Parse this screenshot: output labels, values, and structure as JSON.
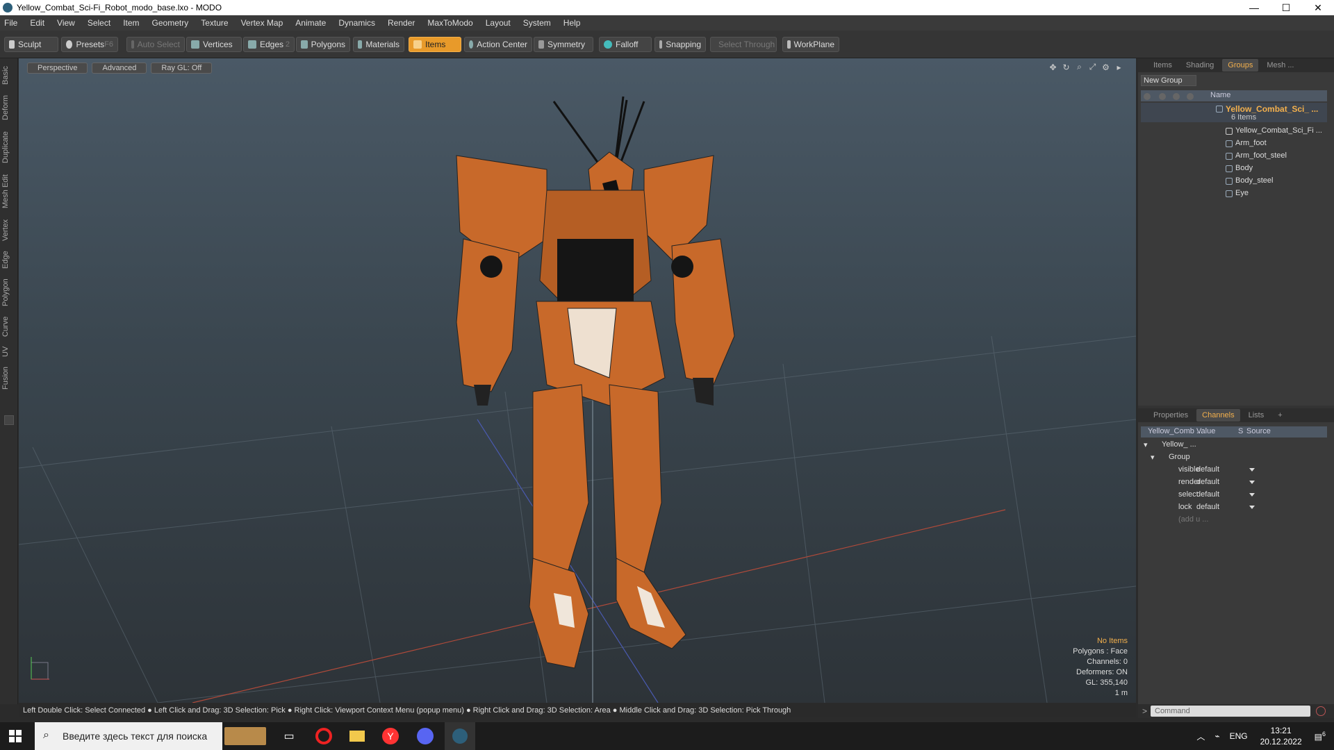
{
  "window": {
    "title": "Yellow_Combat_Sci-Fi_Robot_modo_base.lxo - MODO",
    "min": "—",
    "max": "☐",
    "close": "✕"
  },
  "menu": [
    "File",
    "Edit",
    "View",
    "Select",
    "Item",
    "Geometry",
    "Texture",
    "Vertex Map",
    "Animate",
    "Dynamics",
    "Render",
    "MaxToModo",
    "Layout",
    "System",
    "Help"
  ],
  "toolbar": {
    "sculpt": "Sculpt",
    "presets": "Presets",
    "presets_key": "F6",
    "auto_select": "Auto Select",
    "vertices": "Vertices",
    "edges": "Edges",
    "edges_num": "2",
    "polygons": "Polygons",
    "materials": "Materials",
    "items": "Items",
    "action_center": "Action Center",
    "symmetry": "Symmetry",
    "falloff": "Falloff",
    "snapping": "Snapping",
    "select_through": "Select Through",
    "workplane": "WorkPlane"
  },
  "left_tabs": [
    "Basic",
    "Deform",
    "Duplicate",
    "Mesh Edit",
    "Vertex",
    "Edge",
    "Polygon",
    "Curve",
    "UV",
    "Fusion"
  ],
  "viewport": {
    "tabs": [
      "Perspective",
      "Advanced",
      "Ray GL: Off"
    ],
    "stats": {
      "selection": "No Items",
      "polygons": "Polygons : Face",
      "channels": "Channels: 0",
      "deformers": "Deformers: ON",
      "gl": "GL: 355,140",
      "scale": "1 m"
    }
  },
  "status": "Left Double Click: Select Connected ● Left Click and Drag: 3D Selection: Pick ● Right Click: Viewport Context Menu (popup menu) ● Right Click and Drag: 3D Selection: Area ● Middle Click and Drag: 3D Selection: Pick Through",
  "items_panel": {
    "tabs": [
      "Items",
      "Shading",
      "Groups",
      "Mesh ..."
    ],
    "active_tab": "Groups",
    "new_group": "New Group",
    "col_name": "Name",
    "group_name": "Yellow_Combat_Sci_ ...",
    "group_count": "6 Items",
    "children": [
      "Yellow_Combat_Sci_Fi ...",
      "Arm_foot",
      "Arm_foot_steel",
      "Body",
      "Body_steel",
      "Eye"
    ]
  },
  "channels_panel": {
    "tabs": [
      "Properties",
      "Channels",
      "Lists",
      "+"
    ],
    "active_tab": "Channels",
    "headers": [
      "Yellow_Comb ...",
      "Value",
      "S",
      "Source"
    ],
    "root": "Yellow_ ...",
    "group": "Group",
    "rows": [
      {
        "name": "visible",
        "value": "default"
      },
      {
        "name": "render",
        "value": "default"
      },
      {
        "name": "select",
        "value": "default"
      },
      {
        "name": "lock",
        "value": "default"
      }
    ],
    "add": "(add u ..."
  },
  "command": {
    "prompt": ">",
    "placeholder": "Command"
  },
  "taskbar": {
    "search": "Введите здесь текст для поиска",
    "lang": "ENG",
    "time": "13:21",
    "date": "20.12.2022",
    "notif": "6"
  },
  "colors": {
    "accent": "#f3b04d",
    "robot": "#c8692a",
    "active_tool": "#e89a2a"
  }
}
